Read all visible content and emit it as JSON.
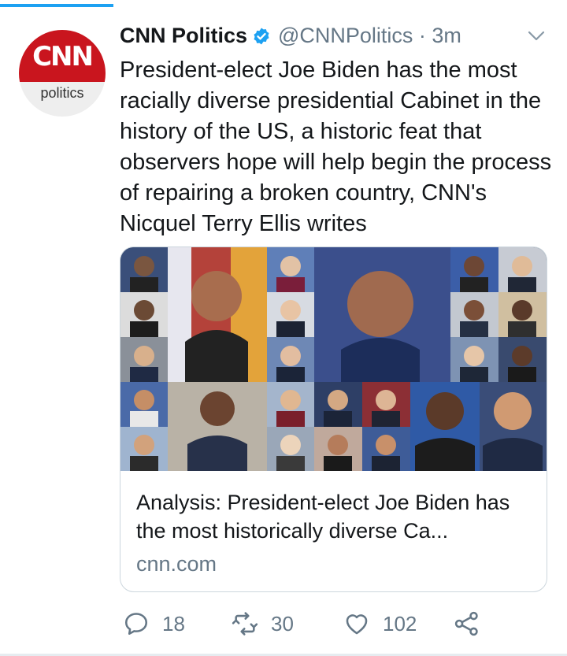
{
  "progress": {
    "fraction": 0.2,
    "color": "#1da1f2"
  },
  "avatar": {
    "logo_text": "CNN",
    "sub_text": "politics"
  },
  "tweet": {
    "display_name": "CNN Politics",
    "handle_time": "@CNNPolitics · 3m",
    "text": "President-elect Joe Biden has the most racially diverse presidential Cabinet in the history of the US, a historic feat that observers hope will help begin the process of repairing a broken country, CNN's Nicquel Terry Ellis writes"
  },
  "card": {
    "image_icon": "cabinet-collage-photo",
    "title": "Analysis: President-elect Joe Biden has the most historically diverse Ca...",
    "domain": "cnn.com"
  },
  "actions": {
    "reply": {
      "icon": "reply-icon",
      "count": "18"
    },
    "retweet": {
      "icon": "retweet-icon",
      "count": "30"
    },
    "like": {
      "icon": "heart-icon",
      "count": "102"
    },
    "share": {
      "icon": "share-icon"
    }
  },
  "colors": {
    "accent": "#1da1f2",
    "cnn_red": "#c9151e",
    "secondary_text": "#657786"
  }
}
